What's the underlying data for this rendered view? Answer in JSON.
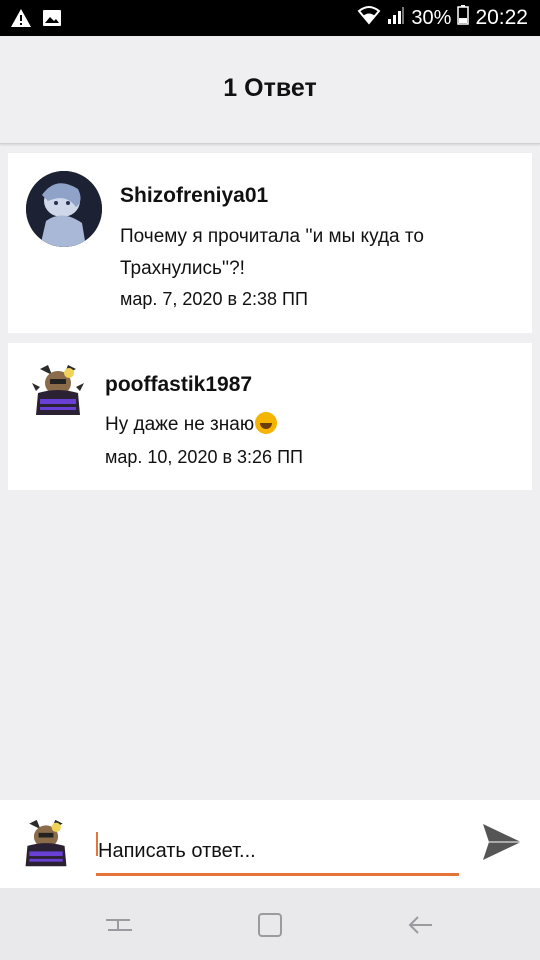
{
  "status_bar": {
    "battery": "30%",
    "time": "20:22",
    "icons": [
      "warning-icon",
      "image-icon",
      "wifi-icon",
      "signal-icon",
      "battery-icon"
    ]
  },
  "header": {
    "title": "1 Ответ"
  },
  "comments": [
    {
      "username": "Shizofreniya01",
      "text": "Почему я прочитала ''и мы куда то Трахнулись''?!",
      "timestamp": "мар. 7, 2020 в 2:38 ПП"
    },
    {
      "username": "pooffastik1987",
      "text": "Ну даже не знаю",
      "emoji": "rolling-on-floor-laughing-emoji",
      "timestamp": "мар. 10, 2020 в 3:26 ПП"
    }
  ],
  "reply": {
    "placeholder": "Написать ответ...",
    "send_icon": "send-icon"
  },
  "nav_bar": {
    "icons": [
      "recent-apps-icon",
      "home-icon",
      "back-icon"
    ]
  },
  "colors": {
    "accent": "#e5743b",
    "background": "#efeff1",
    "card": "#ffffff",
    "status_bar": "#000000"
  }
}
